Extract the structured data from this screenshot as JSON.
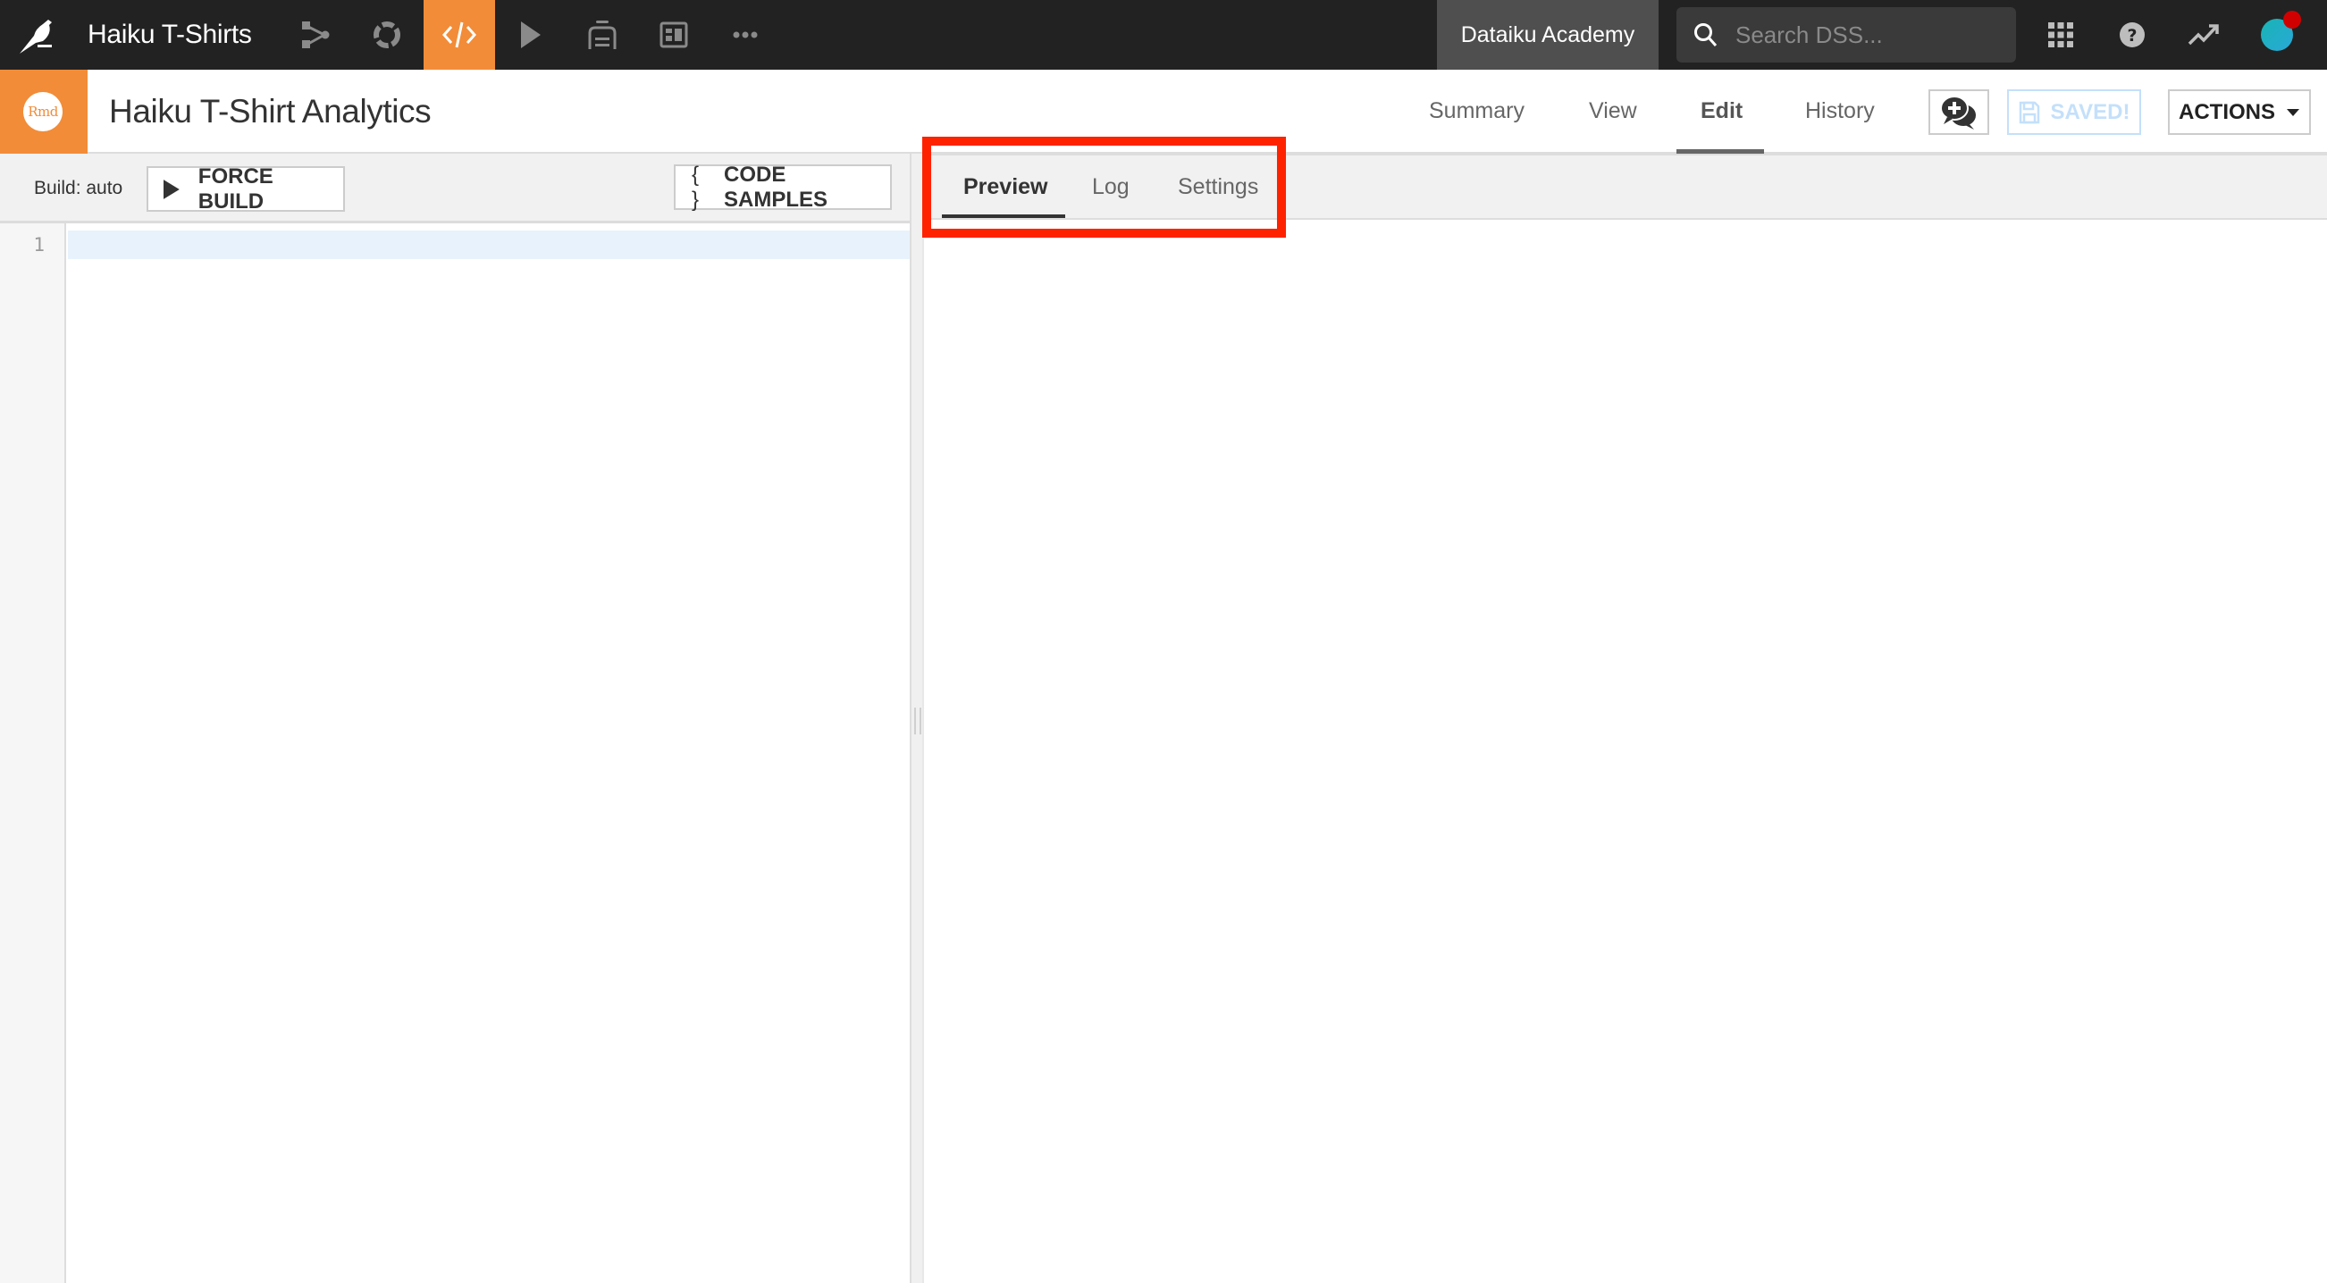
{
  "topbar": {
    "project_name": "Haiku T-Shirts",
    "nav_icons": [
      "flow-icon",
      "lab-icon",
      "code-icon",
      "jobs-icon",
      "deploy-icon",
      "dashboard-icon",
      "more-icon"
    ],
    "active_nav": "code-icon",
    "instance_name": "Dataiku Academy",
    "search_placeholder": "Search DSS...",
    "right_icons": [
      "apps-grid-icon",
      "help-icon",
      "activity-trend-icon",
      "user-avatar"
    ],
    "notification_dot": true,
    "accent_color": "#f28c38"
  },
  "header": {
    "badge_label": "Rmd",
    "title": "Haiku T-Shirt Analytics",
    "tabs": [
      {
        "label": "Summary",
        "active": false
      },
      {
        "label": "View",
        "active": false
      },
      {
        "label": "Edit",
        "active": true
      },
      {
        "label": "History",
        "active": false
      }
    ],
    "saved_label": "SAVED!",
    "actions_label": "ACTIONS"
  },
  "editor_toolbar": {
    "build_label": "Build: auto",
    "force_build_label": "FORCE BUILD",
    "code_samples_icon": "{ }",
    "code_samples_label": "CODE SAMPLES"
  },
  "editor": {
    "lines": [
      {
        "number": "1",
        "text": ""
      }
    ]
  },
  "preview_panel": {
    "tabs": [
      {
        "label": "Preview",
        "active": true
      },
      {
        "label": "Log",
        "active": false
      },
      {
        "label": "Settings",
        "active": false
      }
    ],
    "highlight_color": "#ff2200"
  }
}
